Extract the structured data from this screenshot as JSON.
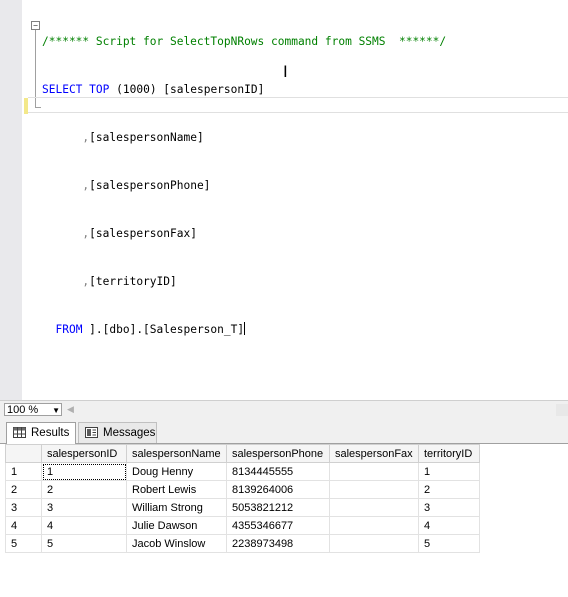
{
  "editor": {
    "comment": "/****** Script for SelectTopNRows command from SSMS  ******/",
    "select_kw": "SELECT",
    "top_kw": "TOP",
    "top_value": "(1000)",
    "col1": " [salespersonID]",
    "lines": [
      ",[salespersonName]",
      ",[salespersonPhone]",
      ",[salespersonFax]",
      ",[territoryID]"
    ],
    "from_kw": "FROM",
    "from_rest": " ].[dbo].[Salesperson_T]",
    "collapse_glyph": "−"
  },
  "toolbar": {
    "zoom_value": "100 %"
  },
  "tabs": {
    "results_label": "Results",
    "messages_label": "Messages"
  },
  "grid": {
    "columns": [
      "salespersonID",
      "salespersonName",
      "salespersonPhone",
      "salespersonFax",
      "territoryID"
    ],
    "rows": [
      {
        "n": "1",
        "cells": [
          "1",
          "Doug Henny",
          "8134445555",
          "",
          "1"
        ]
      },
      {
        "n": "2",
        "cells": [
          "2",
          "Robert Lewis",
          "8139264006",
          "",
          "2"
        ]
      },
      {
        "n": "3",
        "cells": [
          "3",
          "William Strong",
          "5053821212",
          "",
          "3"
        ]
      },
      {
        "n": "4",
        "cells": [
          "4",
          "Julie Dawson",
          "4355346677",
          "",
          "4"
        ]
      },
      {
        "n": "5",
        "cells": [
          "5",
          "Jacob Winslow",
          "2238973498",
          "",
          "5"
        ]
      }
    ]
  },
  "icons": {
    "results": "grid-icon",
    "messages": "messages-icon",
    "dropdown": "chevron-down-icon",
    "scroll_left": "scroll-left-arrow-icon",
    "text_cursor": "ibeam-cursor-icon"
  }
}
